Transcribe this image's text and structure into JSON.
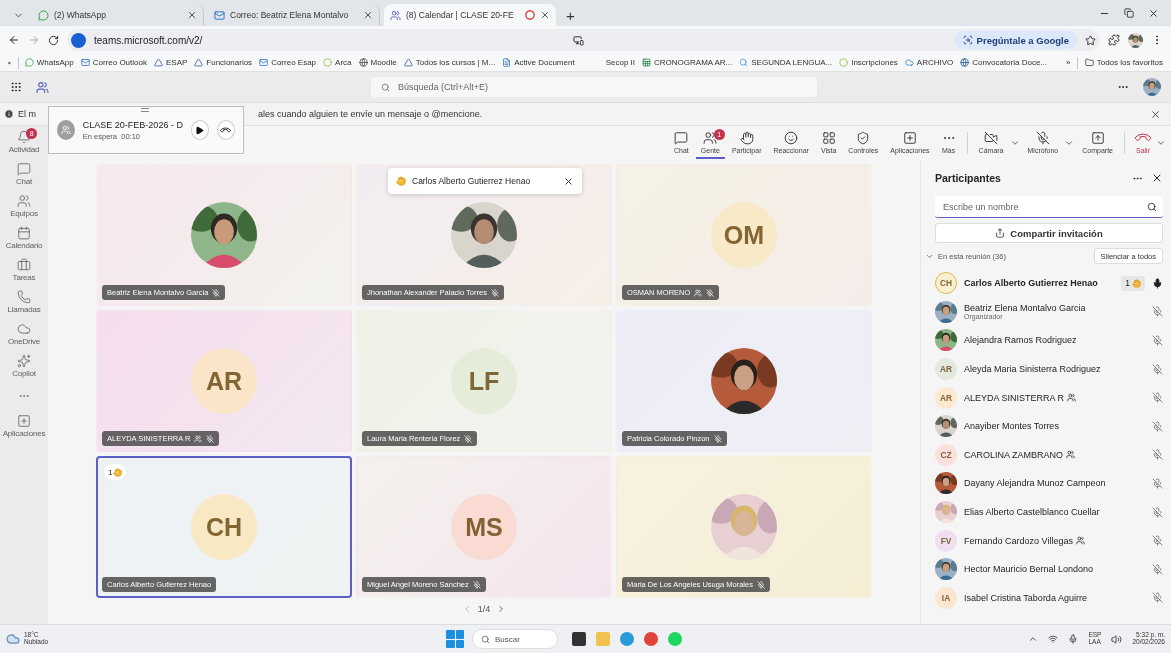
{
  "browser": {
    "tabs": [
      {
        "title": "(2) WhatsApp",
        "selected": false,
        "recording": false
      },
      {
        "title": "Correo: Beatriz Elena Montalvo",
        "selected": false,
        "recording": false
      },
      {
        "title": "(8) Calendar | CLASE 20-FE",
        "selected": true,
        "recording": true
      }
    ],
    "new_tab": "+",
    "url": "teams.microsoft.com/v2/",
    "ask_google": "Pregúntale a Google",
    "bookmarks": [
      "WhatsApp",
      "Correo Outlook",
      "ESAP",
      "Funcionarios",
      "Correo Esap",
      "Arca",
      "Moodle",
      "Todos los cursos | M...",
      "Active Document",
      "Secop II",
      "CRONOGRAMA AR...",
      "SEGUNDA LENGUA...",
      "Inscripciones",
      "ARCHIVO",
      "Convocatoria Doce..."
    ],
    "more_bookmarks": "»",
    "all_favorites": "Todos los favoritos"
  },
  "teams_header": {
    "search_placeholder": "Búsqueda (Ctrl+Alt+E)"
  },
  "notice": {
    "parts": [
      "El m",
      "ales cuando alguien te envíe un mensaje o @mencione."
    ]
  },
  "mini_call": {
    "title": "CLASE 20-FEB-2026 - D",
    "status": "En espera",
    "timer": "00:10"
  },
  "rail": [
    {
      "label": "Actividad",
      "badge": "8"
    },
    {
      "label": "Chat"
    },
    {
      "label": "Equipos"
    },
    {
      "label": "Calendario"
    },
    {
      "label": "Tareas"
    },
    {
      "label": "Llamadas"
    },
    {
      "label": "OneDrive"
    },
    {
      "label": "Copilot"
    },
    {
      "label": "Aplicaciones"
    }
  ],
  "meeting_toolbar": {
    "items": [
      {
        "label": "Chat",
        "kind": "button",
        "selected": false
      },
      {
        "label": "Gente",
        "kind": "button",
        "selected": true,
        "badge": "1"
      },
      {
        "label": "Participar",
        "kind": "button",
        "selected": false
      },
      {
        "label": "Reaccionar",
        "kind": "button",
        "selected": false
      },
      {
        "label": "Vista",
        "kind": "button",
        "selected": false
      },
      {
        "label": "Controles",
        "kind": "button",
        "selected": false
      },
      {
        "label": "Aplicaciones",
        "kind": "button",
        "selected": false
      },
      {
        "label": "Más",
        "kind": "button",
        "selected": false
      },
      {
        "label": "Cámara",
        "kind": "split",
        "selected": false
      },
      {
        "label": "Micrófono",
        "kind": "split",
        "selected": false
      },
      {
        "label": "Comparte",
        "kind": "button",
        "selected": false
      },
      {
        "label": "Salir",
        "kind": "leave",
        "selected": false
      }
    ]
  },
  "toast": {
    "name": "Carlos Alberto Gutierrez Henao"
  },
  "tiles": [
    {
      "name": "Beatriz Elena Montalvo Garcia",
      "guest": false,
      "muted": true,
      "selected": false
    },
    {
      "name": "Jhonathan Alexander Palacio Torres",
      "guest": false,
      "muted": true,
      "selected": false
    },
    {
      "name": "OSMAN MORENO",
      "avatar": {
        "kind": "initials",
        "initials": "OM",
        "color": "#f8eac8"
      },
      "guest": true,
      "muted": true,
      "selected": false
    },
    {
      "name": "ALEYDA SINISTERRA R",
      "avatar": {
        "kind": "initials",
        "initials": "AR",
        "color": "#fbe5c8"
      },
      "guest": true,
      "muted": true,
      "selected": false
    },
    {
      "name": "Laura Maria Renteria Florez",
      "avatar": {
        "kind": "initials",
        "initials": "LF",
        "color": "#e5ecda"
      },
      "guest": false,
      "muted": true,
      "selected": false
    },
    {
      "name": "Patricia Colorado Pinzon",
      "guest": false,
      "muted": true,
      "selected": false
    },
    {
      "name": "Carlos Alberto Gutierrez Henao",
      "avatar": {
        "kind": "initials",
        "initials": "CH",
        "color": "#f8e8c4"
      },
      "guest": false,
      "muted": false,
      "selected": true,
      "hand_raise": "1"
    },
    {
      "name": "Miguel Angel Moreno Sanchez",
      "avatar": {
        "kind": "initials",
        "initials": "MS",
        "color": "#f9dbd4"
      },
      "guest": false,
      "muted": true,
      "selected": false
    },
    {
      "name": "Maria De Los Angeles Usuga Morales",
      "guest": false,
      "muted": true,
      "selected": false
    }
  ],
  "pager": {
    "label": "1/4"
  },
  "participants": {
    "title": "Participantes",
    "search_placeholder": "Escribe un nombre",
    "invite": "Compartir invitación",
    "section": {
      "label": "En esta reunión (36)",
      "expanded": true
    },
    "mute_all": "Silenciar a todos",
    "people": [
      {
        "name": "Carlos Alberto Gutierrez Henao",
        "avatar": {
          "kind": "initials",
          "initials": "CH",
          "color": "#fbefd2"
        },
        "guest": false,
        "muted": false,
        "hand_raise": "1",
        "bold": true
      },
      {
        "name": "Beatriz Elena Montalvo Garcia",
        "subtitle": "Organizador",
        "guest": false,
        "muted": true,
        "bold": false
      },
      {
        "name": "Alejandra Ramos Rodriguez",
        "guest": false,
        "muted": true,
        "bold": false
      },
      {
        "name": "Aleyda Maria Sinisterra Rodriguez",
        "avatar": {
          "kind": "initials",
          "initials": "AR",
          "color": "#e4e9df"
        },
        "guest": false,
        "muted": true,
        "bold": false
      },
      {
        "name": "ALEYDA SINISTERRA R",
        "avatar": {
          "kind": "initials",
          "initials": "AR",
          "color": "#fde8d0"
        },
        "guest": true,
        "muted": true,
        "bold": false
      },
      {
        "name": "Anayiber Montes Torres",
        "guest": false,
        "muted": true,
        "bold": false
      },
      {
        "name": "CAROLINA ZAMBRANO",
        "avatar": {
          "kind": "initials",
          "initials": "CZ",
          "color": "#fbe1dd"
        },
        "guest": true,
        "muted": true,
        "bold": false
      },
      {
        "name": "Dayany Alejandra Munoz Campeon",
        "guest": false,
        "muted": true,
        "bold": false
      },
      {
        "name": "Elias Alberto Castelblanco Cuellar",
        "guest": false,
        "muted": true,
        "bold": false
      },
      {
        "name": "Fernando Cardozo Villegas",
        "avatar": {
          "kind": "initials",
          "initials": "FV",
          "color": "#efdff0"
        },
        "guest": true,
        "muted": true,
        "bold": false
      },
      {
        "name": "Hector Mauricio Bernal Londono",
        "guest": false,
        "muted": true,
        "bold": false
      },
      {
        "name": "Isabel Cristina Taborda Aguirre",
        "avatar": {
          "kind": "initials",
          "initials": "IA",
          "color": "#fde6d1"
        },
        "guest": false,
        "muted": true,
        "bold": false
      }
    ]
  },
  "taskbar": {
    "temperature": "18°C",
    "weather": "Nublado",
    "search": "Buscar",
    "language": "ESP",
    "layout": "LAA",
    "time": "5:32 p. m.",
    "date": "20/02/2026"
  }
}
